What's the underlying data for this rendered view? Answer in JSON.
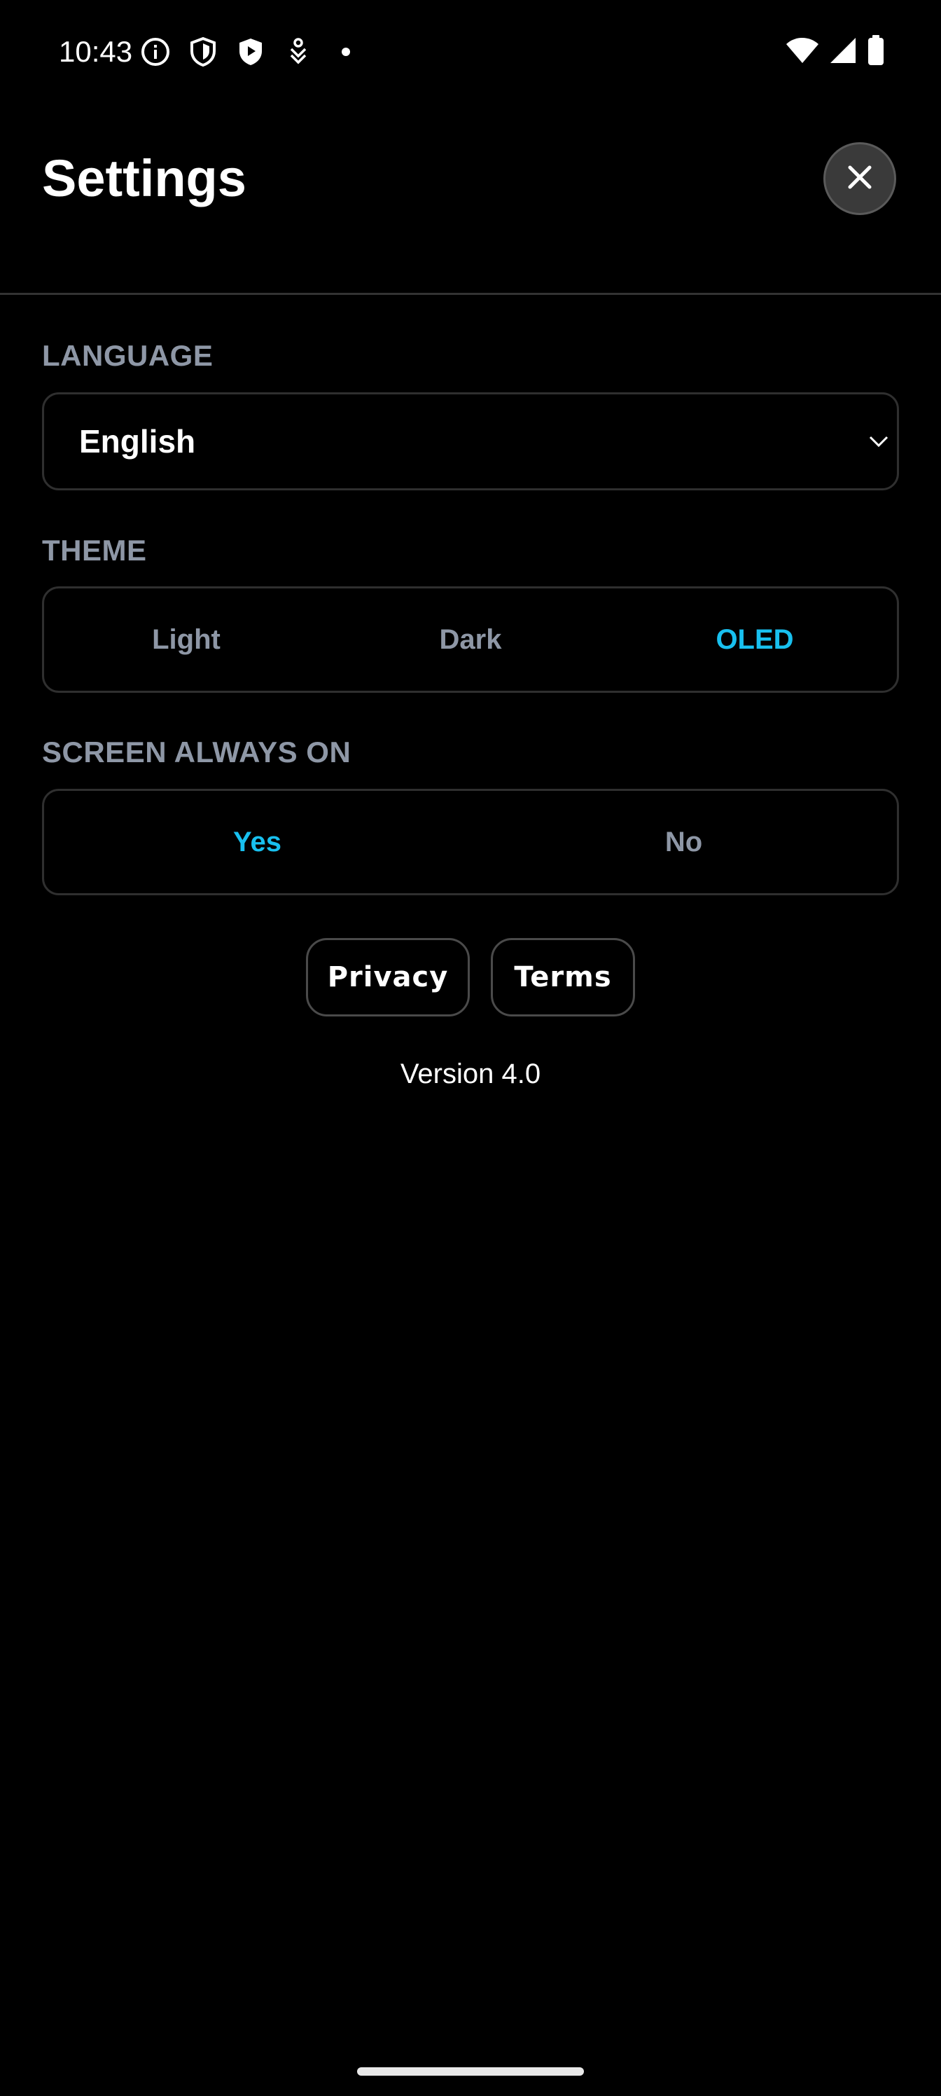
{
  "status_bar": {
    "time": "10:43",
    "left_icons": [
      "info-icon",
      "shield-icon",
      "play-shield-icon",
      "download-icon",
      "dot-icon"
    ],
    "right_icons": [
      "wifi-icon",
      "cellular-signal-icon",
      "battery-icon"
    ]
  },
  "header": {
    "title": "Settings",
    "close_icon": "close-icon"
  },
  "language": {
    "label": "LANGUAGE",
    "selected": "English"
  },
  "theme": {
    "label": "THEME",
    "options": [
      "Light",
      "Dark",
      "OLED"
    ],
    "selected": "OLED"
  },
  "screen_always_on": {
    "label": "SCREEN ALWAYS ON",
    "options": [
      "Yes",
      "No"
    ],
    "selected": "Yes"
  },
  "links": {
    "privacy": "Privacy",
    "terms": "Terms"
  },
  "version": "Version 4.0",
  "colors": {
    "background": "#000000",
    "accent": "#18c0ef",
    "muted_text": "#8e97a6",
    "border": "#2f2f2f"
  }
}
